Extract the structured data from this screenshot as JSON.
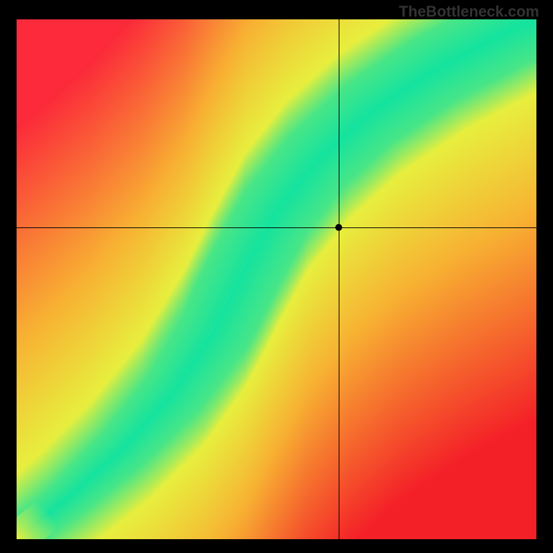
{
  "watermark": "TheBottleneck.com",
  "chart_data": {
    "type": "heatmap",
    "title": "",
    "xlabel": "",
    "ylabel": "",
    "xlim": [
      0,
      100
    ],
    "ylim": [
      0,
      100
    ],
    "crosshair": {
      "x": 62,
      "y": 60
    },
    "marker": {
      "x": 62,
      "y": 60
    },
    "ridge_path": [
      {
        "x": 0,
        "y": 0
      },
      {
        "x": 10,
        "y": 8
      },
      {
        "x": 20,
        "y": 17
      },
      {
        "x": 30,
        "y": 28
      },
      {
        "x": 38,
        "y": 40
      },
      {
        "x": 44,
        "y": 52
      },
      {
        "x": 50,
        "y": 63
      },
      {
        "x": 58,
        "y": 73
      },
      {
        "x": 68,
        "y": 82
      },
      {
        "x": 80,
        "y": 90
      },
      {
        "x": 95,
        "y": 98
      },
      {
        "x": 100,
        "y": 100
      }
    ],
    "ridge_note": "Green optimal curve; surrounding field transitions yellow→orange→red with distance from ridge.",
    "colors": {
      "ridge": "#14e3a0",
      "near": "#e8ef3e",
      "mid": "#f8b233",
      "far_tl": "#fc2a3a",
      "far_br": "#f42028"
    },
    "grid": false,
    "legend": null
  }
}
